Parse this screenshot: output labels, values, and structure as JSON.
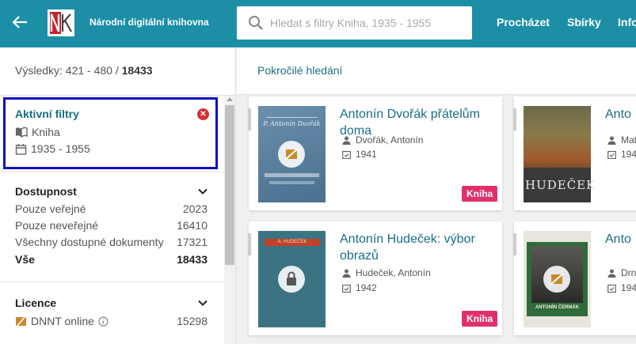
{
  "header": {
    "brand": "Národní digitální knihovna",
    "logo_text": "NK",
    "search_placeholder": "Hledat s filtry Kniha, 1935 - 1955",
    "nav": [
      "Procházet",
      "Sbírky",
      "Info"
    ]
  },
  "sidebar": {
    "results_label": "Výsledky: 421 - 480 /",
    "results_total": "18433",
    "active_filters": {
      "title": "Aktivní filtry",
      "filters": [
        "Kniha",
        "1935 - 1955"
      ]
    },
    "availability": {
      "title": "Dostupnost",
      "items": [
        {
          "label": "Pouze veřejné",
          "count": "2023"
        },
        {
          "label": "Pouze neveřejné",
          "count": "16410"
        },
        {
          "label": "Všechny dostupné dokumenty",
          "count": "17321"
        },
        {
          "label": "Vše",
          "count": "18433"
        }
      ]
    },
    "license": {
      "title": "Licence",
      "items": [
        {
          "label": "DNNT online",
          "count": "15298"
        }
      ]
    }
  },
  "main": {
    "advanced_search": "Pokročilé hledání",
    "cards": [
      {
        "title": "Antonín Dvořák přátelům doma",
        "author": "Dvořák, Antonín",
        "year": "1941",
        "type": "Kniha",
        "cover_text": "P. Antonín Dvořák"
      },
      {
        "title": "Anto",
        "author": "Mat",
        "year": "194",
        "type": "",
        "cover_text": "HUDEČEK"
      },
      {
        "title": "Antonín Hudeček: výbor obrazů",
        "author": "Hudeček, Antonín",
        "year": "1942",
        "type": "Kniha",
        "cover_text": "A. HUDEČEK"
      },
      {
        "title": "Anto",
        "author": "Drn",
        "year": "194",
        "type": "",
        "cover_text": "ANTONÍN ČERMÁK"
      }
    ]
  },
  "colors": {
    "header": "#1c8fa7",
    "link": "#1a6e85",
    "badge": "#e0306a",
    "filter_border": "#1010c0"
  }
}
